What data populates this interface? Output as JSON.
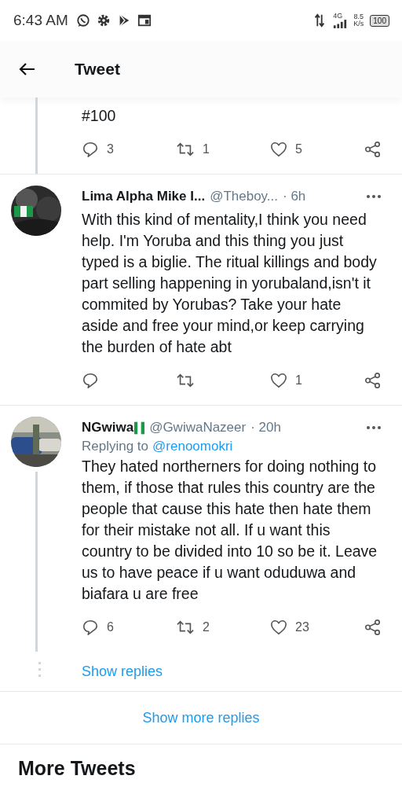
{
  "status_bar": {
    "time": "6:43 AM",
    "network": "4G",
    "speed": "8.5",
    "speed_unit": "K/s",
    "battery": "100"
  },
  "header": {
    "title": "Tweet"
  },
  "tweets": [
    {
      "kind": "continued",
      "text": "#100",
      "replies": "3",
      "retweets": "1",
      "likes": "5",
      "thread_line": true
    },
    {
      "kind": "full",
      "name": "Lima Alpha Mike I...",
      "flag": false,
      "handle": "@Theboy...",
      "time": "· 6h",
      "text": "With this kind of mentality,I think you need help. I'm Yoruba and this thing you just typed is a biglie. The ritual killings and body part selling happening in yorubaland,isn't it commited by Yorubas? Take your hate aside and free your mind,or keep carrying the burden of hate abt",
      "likes": "1",
      "thread_line": false
    },
    {
      "kind": "full",
      "name": "NGwiwa",
      "flag": true,
      "handle": "@GwiwaNazeer",
      "time": "· 20h",
      "replying_label": "Replying to",
      "replying_to": "@renoomokri",
      "text": "They hated northerners for doing nothing to them, if those that rules this country are the people that cause this hate then hate them for their mistake not all. If u want this country to be divided into 10 so be it. Leave us to have peace if u want oduduwa and biafara u are free",
      "replies": "6",
      "retweets": "2",
      "likes": "23",
      "thread_line": true
    }
  ],
  "show_replies": "Show replies",
  "show_more_replies": "Show more replies",
  "section_title": "More Tweets"
}
